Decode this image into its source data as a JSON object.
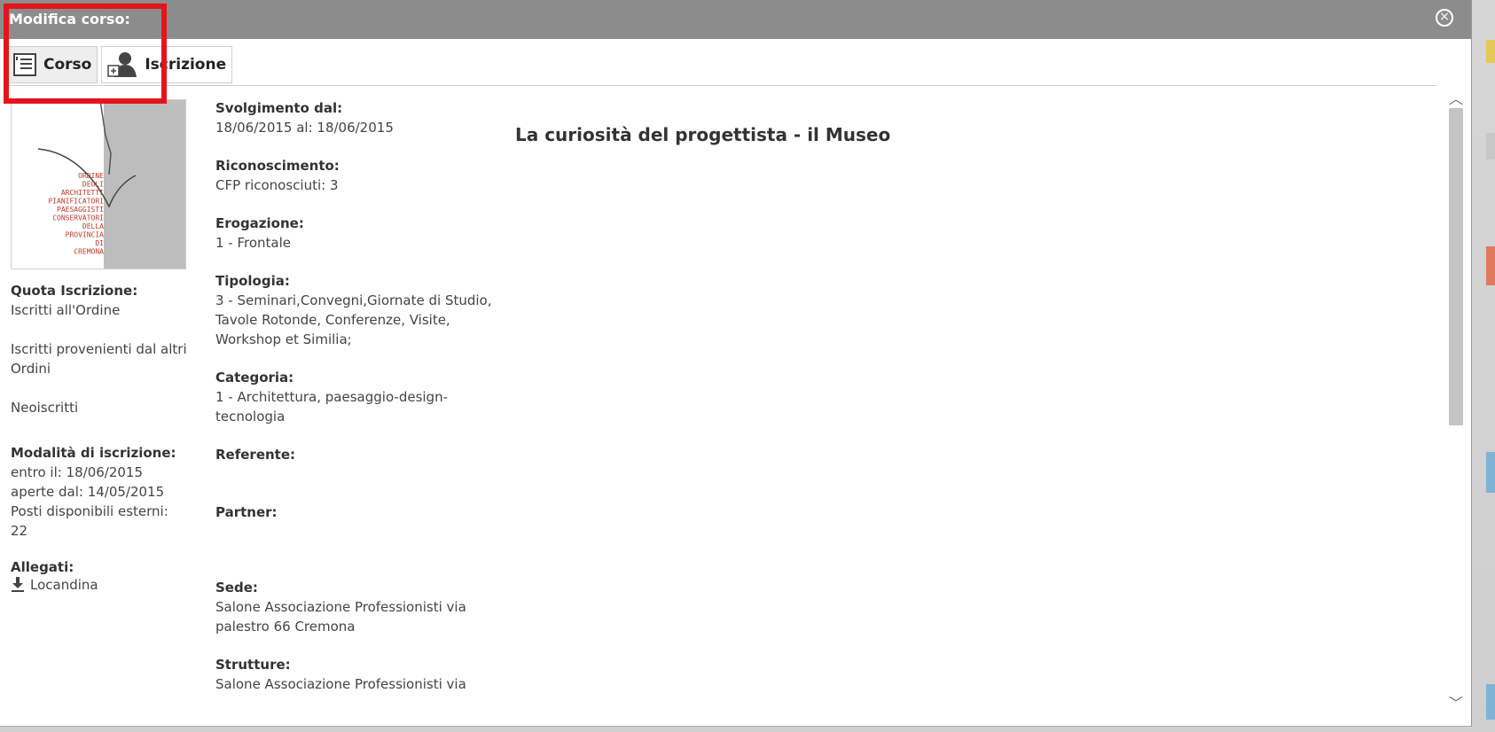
{
  "dialog": {
    "title": "Modifica corso:",
    "close_icon": "close-circle-icon"
  },
  "tabs": [
    {
      "label": "Corso",
      "icon": "list-document-icon"
    },
    {
      "label": "Iscrizione",
      "icon": "add-user-icon"
    }
  ],
  "logo": {
    "text_lines": [
      "ORDINE",
      "DEGLI",
      "ARCHITETTI",
      "PIANIFICATORI",
      "PAESAGGISTI",
      "CONSERVATORI",
      "DELLA",
      "PROVINCIA",
      "DI",
      "CREMONA"
    ]
  },
  "course": {
    "title": "La curiosità del progettista - il Museo"
  },
  "left": {
    "quota_label": "Quota Iscrizione:",
    "quota_items": [
      "Iscritti all'Ordine",
      "Iscritti provenienti dal altri Ordini",
      "Neoiscritti"
    ],
    "modalita_label": "Modalità di iscrizione:",
    "modalita_lines": [
      "entro il: 18/06/2015",
      "aperte dal: 14/05/2015",
      "Posti disponibili esterni: 22"
    ],
    "allegati_label": "Allegati:",
    "allegato_name": "Locandina"
  },
  "details": {
    "svolgimento_label": "Svolgimento dal:",
    "svolgimento_value": "18/06/2015 al: 18/06/2015",
    "riconoscimento_label": "Riconoscimento:",
    "riconoscimento_value": "CFP riconosciuti: 3",
    "erogazione_label": "Erogazione:",
    "erogazione_value": "1 - Frontale",
    "tipologia_label": "Tipologia:",
    "tipologia_value": "3 - Seminari,Convegni,Giornate di Studio, Tavole Rotonde, Conferenze, Visite, Workshop et Similia;",
    "categoria_label": "Categoria:",
    "categoria_value": "1 - Architettura, paesaggio-design-tecnologia",
    "referente_label": "Referente:",
    "partner_label": "Partner:",
    "sede_label": "Sede:",
    "sede_value": "Salone Associazione Professionisti via palestro 66 Cremona",
    "strutture_label": "Strutture:",
    "strutture_value": "Salone Associazione Professionisti via"
  },
  "colors": {
    "titlebar": "#8c8c8c",
    "highlight": "#e3141b",
    "logo_text": "#c0392b"
  }
}
